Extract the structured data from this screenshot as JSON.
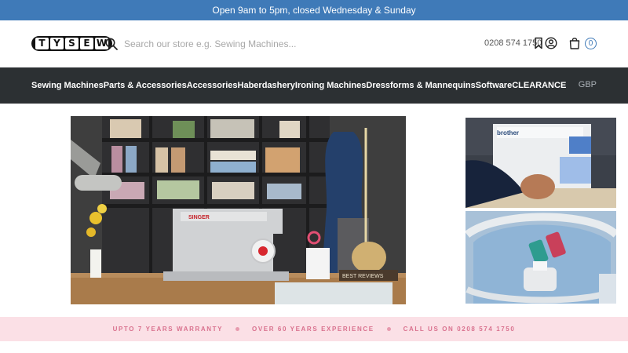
{
  "announcement": {
    "text": "Open 9am to 5pm, closed Wednesday & Sunday"
  },
  "header": {
    "logo_letters": [
      "T",
      "Y",
      "S",
      "E",
      "W"
    ],
    "search_placeholder": "Search our store e.g. Sewing Machines...",
    "phone": "0208 574 1750",
    "cart_count": "0",
    "icons": [
      "search-icon",
      "bookmark-icon",
      "account-icon",
      "cart-icon"
    ]
  },
  "nav": {
    "items": [
      {
        "label": "Sewing Machines"
      },
      {
        "label": "Parts & Accessories"
      },
      {
        "label": "Accessories"
      },
      {
        "label": "Haberdashery"
      },
      {
        "label": "Ironing Machines"
      },
      {
        "label": "Dressforms & Mannequins"
      },
      {
        "label": "Software"
      },
      {
        "label": "CLEARANCE"
      }
    ],
    "currency": "GBP"
  },
  "hero": {
    "machine_brand": "SINGER",
    "reviews_label": "BEST REVIEWS"
  },
  "side_banners": {
    "top_machine_brand": "brother"
  },
  "usp": {
    "items": [
      "UPTO 7 YEARS WARRANTY",
      "OVER 60 YEARS EXPERIENCE",
      "CALL US ON 0208 574 1750"
    ]
  },
  "colors": {
    "announcement_bg": "#3f7ab8",
    "nav_bg": "#2c3033",
    "usp_bg": "#fbe0e6",
    "usp_text": "#d9718e"
  }
}
